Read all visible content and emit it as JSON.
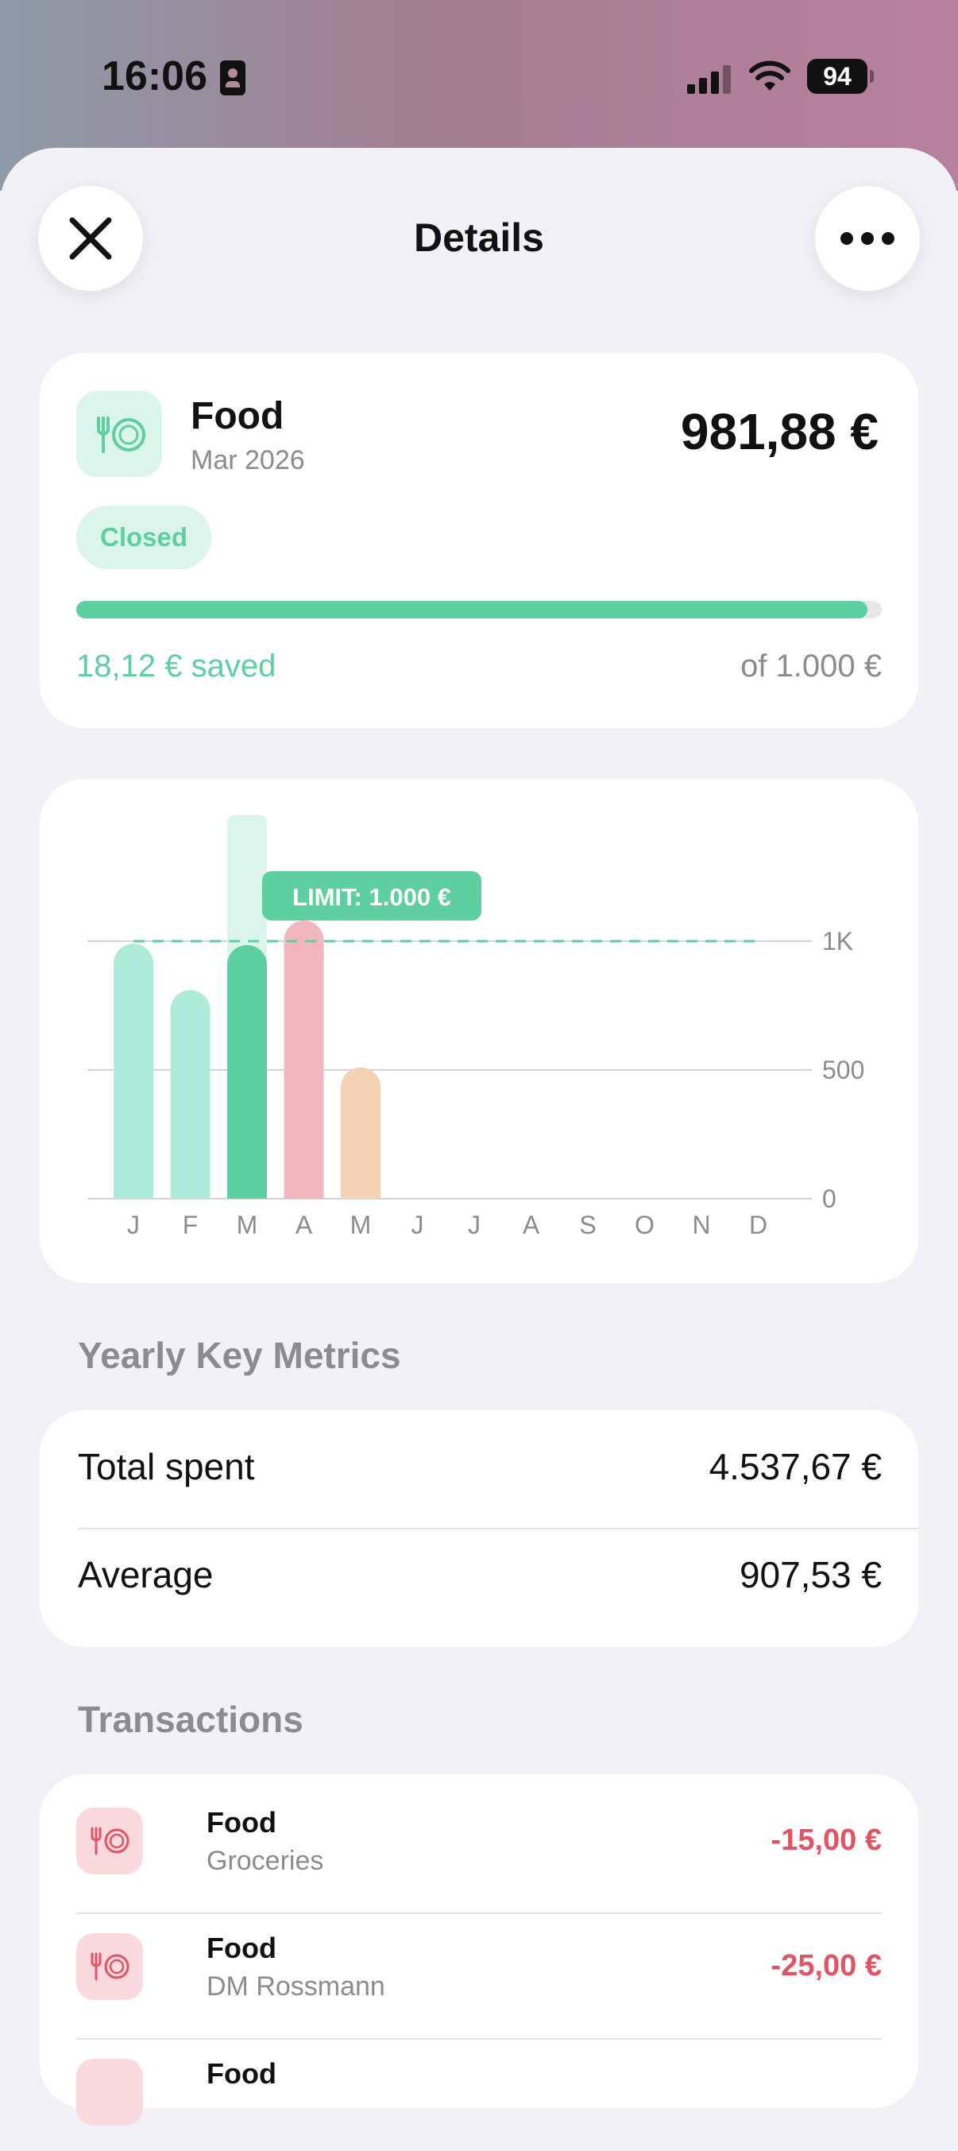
{
  "status_bar": {
    "time": "16:06",
    "battery": "94"
  },
  "header": {
    "title": "Details"
  },
  "summary": {
    "category": "Food",
    "period": "Mar 2026",
    "amount": "981,88 €",
    "badge": "Closed",
    "progress": 0.982,
    "saved_text": "18,12 € saved",
    "of_text": "of 1.000 €"
  },
  "chart_data": {
    "type": "bar",
    "categories": [
      "J",
      "F",
      "M",
      "A",
      "M",
      "J",
      "J",
      "A",
      "S",
      "O",
      "N",
      "D"
    ],
    "values": [
      990,
      810,
      985,
      1080,
      510,
      null,
      null,
      null,
      null,
      null,
      null,
      null
    ],
    "ghost_value_march": 1490,
    "limit": 1000,
    "limit_label": "LIMIT: 1.000 €",
    "y_ticks": [
      {
        "v": 0,
        "label": "0"
      },
      {
        "v": 500,
        "label": "500"
      },
      {
        "v": 1000,
        "label": "1K"
      }
    ],
    "ylim": [
      0,
      1500
    ],
    "colors": {
      "default": "#afebd9",
      "current": "#5dcfa0",
      "over": "#f2b6bf",
      "in_progress": "#f3d2b5",
      "ghost": "#dbf5ec",
      "limit": "#5dcfa0"
    },
    "grid": true
  },
  "metrics": {
    "title": "Yearly Key Metrics",
    "rows": [
      {
        "label": "Total spent",
        "value": "4.537,67 €"
      },
      {
        "label": "Average",
        "value": "907,53 €"
      }
    ]
  },
  "transactions": {
    "title": "Transactions",
    "rows": [
      {
        "title": "Food",
        "subtitle": "Groceries",
        "amount": "-15,00 €"
      },
      {
        "title": "Food",
        "subtitle": "DM Rossmann",
        "amount": "-25,00 €"
      },
      {
        "title": "Food",
        "subtitle": "",
        "amount": ""
      }
    ]
  }
}
